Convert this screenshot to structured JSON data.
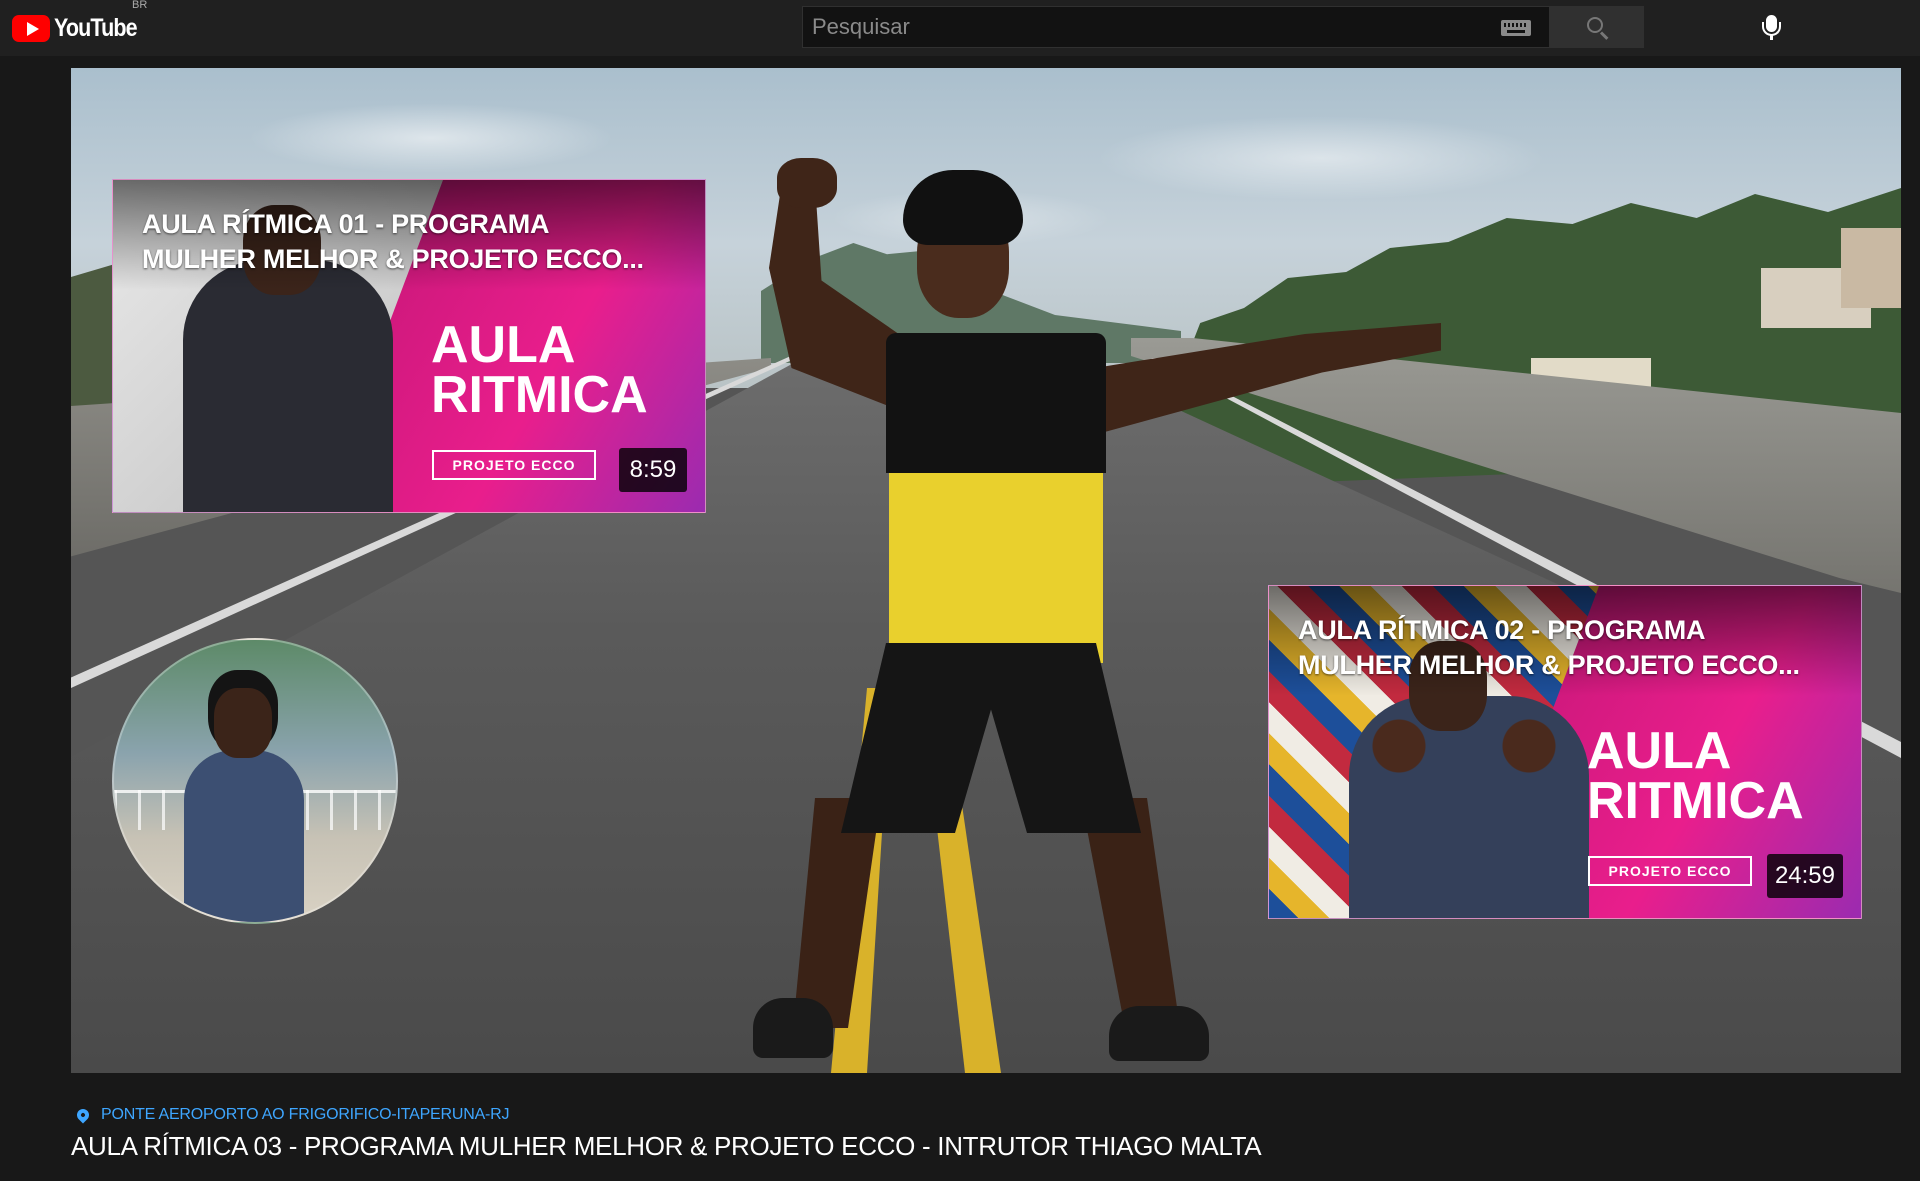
{
  "masthead": {
    "logo_text": "YouTube",
    "country_code": "BR",
    "search_placeholder": "Pesquisar",
    "icons": {
      "logo": "youtube-play-icon",
      "keyboard": "keyboard-icon",
      "search": "search-icon",
      "mic": "mic-icon"
    }
  },
  "player": {
    "endscreen": {
      "cards": [
        {
          "title_line1": "AULA RÍTMICA 01 - PROGRAMA",
          "title_line2": "MULHER MELHOR & PROJETO ECCO...",
          "big_label": "AULA\nRITMICA",
          "brand": "PROJETO ECCO",
          "duration": "8:59"
        },
        {
          "title_line1": "AULA RÍTMICA 02 - PROGRAMA",
          "title_line2": "MULHER MELHOR & PROJETO ECCO...",
          "big_label": "AULA\nRITMICA",
          "brand": "PROJETO ECCO",
          "duration": "24:59"
        }
      ]
    }
  },
  "info": {
    "location": "PONTE AEROPORTO AO FRIGORIFICO-ITAPERUNA-RJ",
    "title": "AULA RÍTMICA 03 - PROGRAMA MULHER MELHOR & PROJETO ECCO - INTRUTOR THIAGO MALTA"
  },
  "colors": {
    "background": "#181818",
    "masthead": "#202020",
    "link_blue": "#3ea6ff",
    "brand_red": "#ff0000",
    "card_pink": "#e91e8c"
  }
}
